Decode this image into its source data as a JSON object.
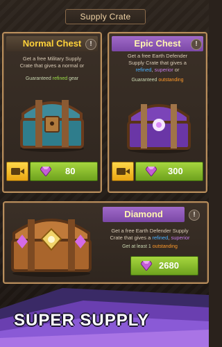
{
  "header": {
    "title": "Supply Crate"
  },
  "normal": {
    "title": "Normal Chest",
    "desc_line1": "Get a free Military Supply",
    "desc_line2": "Crate that gives a normal or",
    "guarantee_prefix": "Guaranteed ",
    "guarantee_value": "refined",
    "guarantee_suffix": " gear",
    "price": "80"
  },
  "epic": {
    "title": "Epic Chest",
    "desc_line1": "Get a free Earth Defender",
    "desc_line2": "Supply Crate that gives a",
    "desc_line3_a": "refined",
    "desc_line3_b": ", ",
    "desc_line3_c": "superior",
    "desc_line3_d": " or",
    "guarantee_prefix": "Guaranteed ",
    "guarantee_value": "outstanding",
    "price": "300"
  },
  "diamond": {
    "title": "Diamond",
    "desc_line1": "Get a free Earth Defender Supply",
    "desc_line2_a": "Crate that gives a ",
    "desc_line2_b": "refined",
    "desc_line2_c": ", ",
    "desc_line2_d": "superior",
    "guarantee_prefix": "Get at least 1 ",
    "guarantee_value": "outstanding",
    "price": "2680"
  },
  "banner": {
    "text": "SUPER SUPPLY"
  },
  "info_glyph": "!",
  "colors": {
    "gold": "#ffd23a",
    "purple": "#8e5bbd",
    "green_btn": "#8cc12e",
    "yellow_btn": "#f2c230"
  },
  "icons": [
    "info-icon",
    "video-camera-icon",
    "gem-icon",
    "chest-icon"
  ]
}
